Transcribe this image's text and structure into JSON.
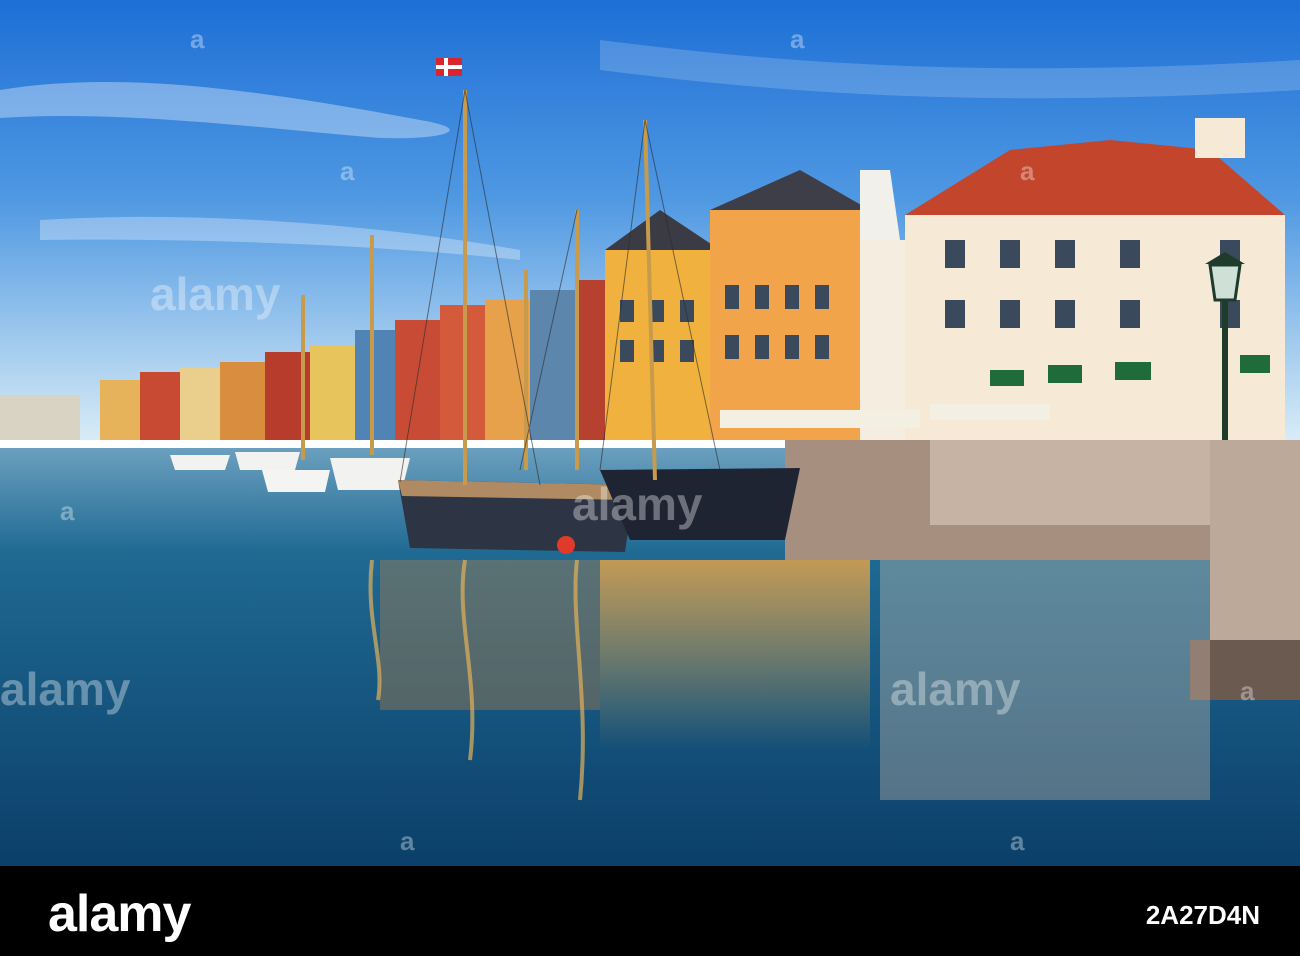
{
  "watermark": {
    "brand": "alamy",
    "mark": "a"
  },
  "footer": {
    "logo": "alamy",
    "stock_id": "2A27D4N"
  },
  "colors": {
    "sky_top": "#1d6fd6",
    "water": "#0d4a77",
    "footer": "#000000"
  }
}
